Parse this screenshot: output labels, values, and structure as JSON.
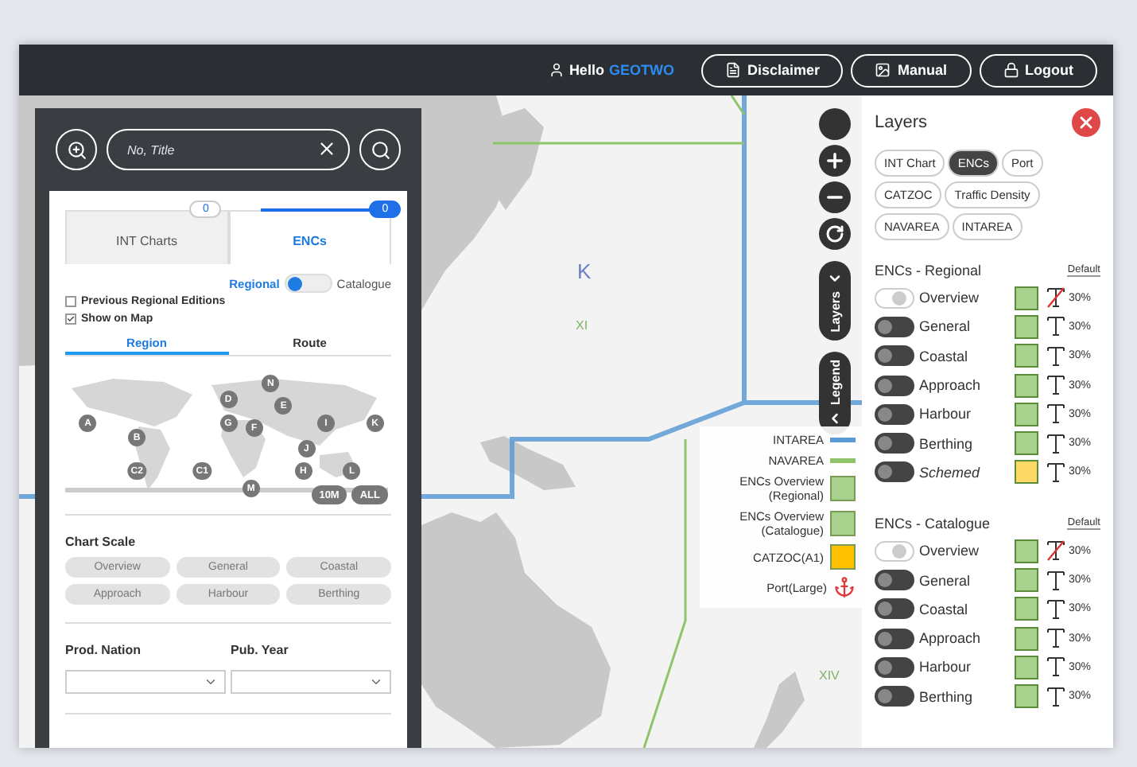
{
  "top_bar": {
    "greeting": "Hello",
    "user": "GEOTWO",
    "buttons": [
      {
        "kind": "disclaimer",
        "label": "Disclaimer"
      },
      {
        "kind": "manual",
        "label": "Manual"
      },
      {
        "kind": "logout",
        "label": "Logout"
      }
    ]
  },
  "search_panel": {
    "search": {
      "placeholder": "No, Title"
    },
    "chart_tabs": [
      {
        "label": "INT Charts",
        "count": "0",
        "selected": false
      },
      {
        "label": "ENCs",
        "count": "0",
        "selected": true
      }
    ],
    "mode_switch": {
      "left_label": "Regional",
      "right_label": "Catalogue",
      "on": false
    },
    "checkboxes": [
      {
        "label": "Previous Regional Editions",
        "checked": false
      },
      {
        "label": "Show on Map",
        "checked": true
      }
    ],
    "region_tabs": [
      {
        "label": "Region",
        "selected": true
      },
      {
        "label": "Route",
        "selected": false
      }
    ],
    "region_pins": [
      "N",
      "D",
      "E",
      "A",
      "G",
      "F",
      "I",
      "K",
      "B",
      "J",
      "C2",
      "C1",
      "H",
      "L",
      "M"
    ],
    "map_buttons": [
      "10M",
      "ALL"
    ],
    "chart_scale": {
      "title": "Chart Scale",
      "options": [
        "Overview",
        "General",
        "Coastal",
        "Approach",
        "Harbour",
        "Berthing"
      ]
    },
    "filters": [
      {
        "label": "Prod. Nation"
      },
      {
        "label": "Pub. Year"
      }
    ]
  },
  "map": {
    "labels": [
      {
        "text": "K",
        "color": "#6b7fc4"
      },
      {
        "text": "XI",
        "color": "#7fb36a"
      },
      {
        "text": "XIV",
        "color": "#7fb36a"
      }
    ],
    "side_tabs": [
      {
        "kind": "layers",
        "label": "Layers"
      },
      {
        "kind": "legend",
        "label": "Legend"
      }
    ],
    "legend": [
      {
        "kind": "line",
        "label": "INTAREA",
        "color": "#5b9bd5"
      },
      {
        "kind": "line",
        "label": "NAVAREA",
        "color": "#8fc46b"
      },
      {
        "kind": "swatch",
        "label": "ENCs Overview (Regional)",
        "color": "#a9d18e"
      },
      {
        "kind": "swatch",
        "label": "ENCs Overview (Catalogue)",
        "color": "#a9d18e"
      },
      {
        "kind": "swatch",
        "label": "CATZOC(A1)",
        "color": "#ffc000"
      },
      {
        "kind": "port",
        "label": "Port(Large)"
      }
    ]
  },
  "layers_panel": {
    "title": "Layers",
    "chips": [
      {
        "label": "INT Chart",
        "selected": false
      },
      {
        "label": "ENCs",
        "selected": true
      },
      {
        "label": "Port",
        "selected": false
      },
      {
        "label": "CATZOC",
        "selected": false
      },
      {
        "label": "Traffic Density",
        "selected": false
      },
      {
        "label": "NAVAREA",
        "selected": false
      },
      {
        "label": "INTAREA",
        "selected": false
      }
    ],
    "sections": [
      {
        "title": "ENCs - Regional",
        "reset": "Default",
        "rows": [
          {
            "name": "Overview",
            "on": true,
            "italic": false,
            "color": "#a9d18e",
            "label_hidden": true,
            "opacity": "30%"
          },
          {
            "name": "General",
            "on": false,
            "italic": false,
            "color": "#a9d18e",
            "label_hidden": false,
            "opacity": "30%"
          },
          {
            "name": "Coastal",
            "on": false,
            "italic": false,
            "color": "#a9d18e",
            "label_hidden": false,
            "opacity": "30%"
          },
          {
            "name": "Approach",
            "on": false,
            "italic": false,
            "color": "#a9d18e",
            "label_hidden": false,
            "opacity": "30%"
          },
          {
            "name": "Harbour",
            "on": false,
            "italic": false,
            "color": "#a9d18e",
            "label_hidden": false,
            "opacity": "30%"
          },
          {
            "name": "Berthing",
            "on": false,
            "italic": false,
            "color": "#a9d18e",
            "label_hidden": false,
            "opacity": "30%"
          },
          {
            "name": "Schemed",
            "on": false,
            "italic": true,
            "color": "#ffd966",
            "label_hidden": false,
            "opacity": "30%"
          }
        ]
      },
      {
        "title": "ENCs - Catalogue",
        "reset": "Default",
        "rows": [
          {
            "name": "Overview",
            "on": true,
            "italic": false,
            "color": "#a9d18e",
            "label_hidden": true,
            "opacity": "30%"
          },
          {
            "name": "General",
            "on": false,
            "italic": false,
            "color": "#a9d18e",
            "label_hidden": false,
            "opacity": "30%"
          },
          {
            "name": "Coastal",
            "on": false,
            "italic": false,
            "color": "#a9d18e",
            "label_hidden": false,
            "opacity": "30%"
          },
          {
            "name": "Approach",
            "on": false,
            "italic": false,
            "color": "#a9d18e",
            "label_hidden": false,
            "opacity": "30%"
          },
          {
            "name": "Harbour",
            "on": false,
            "italic": false,
            "color": "#a9d18e",
            "label_hidden": false,
            "opacity": "30%"
          },
          {
            "name": "Berthing",
            "on": false,
            "italic": false,
            "color": "#a9d18e",
            "label_hidden": false,
            "opacity": "30%"
          }
        ]
      }
    ]
  }
}
